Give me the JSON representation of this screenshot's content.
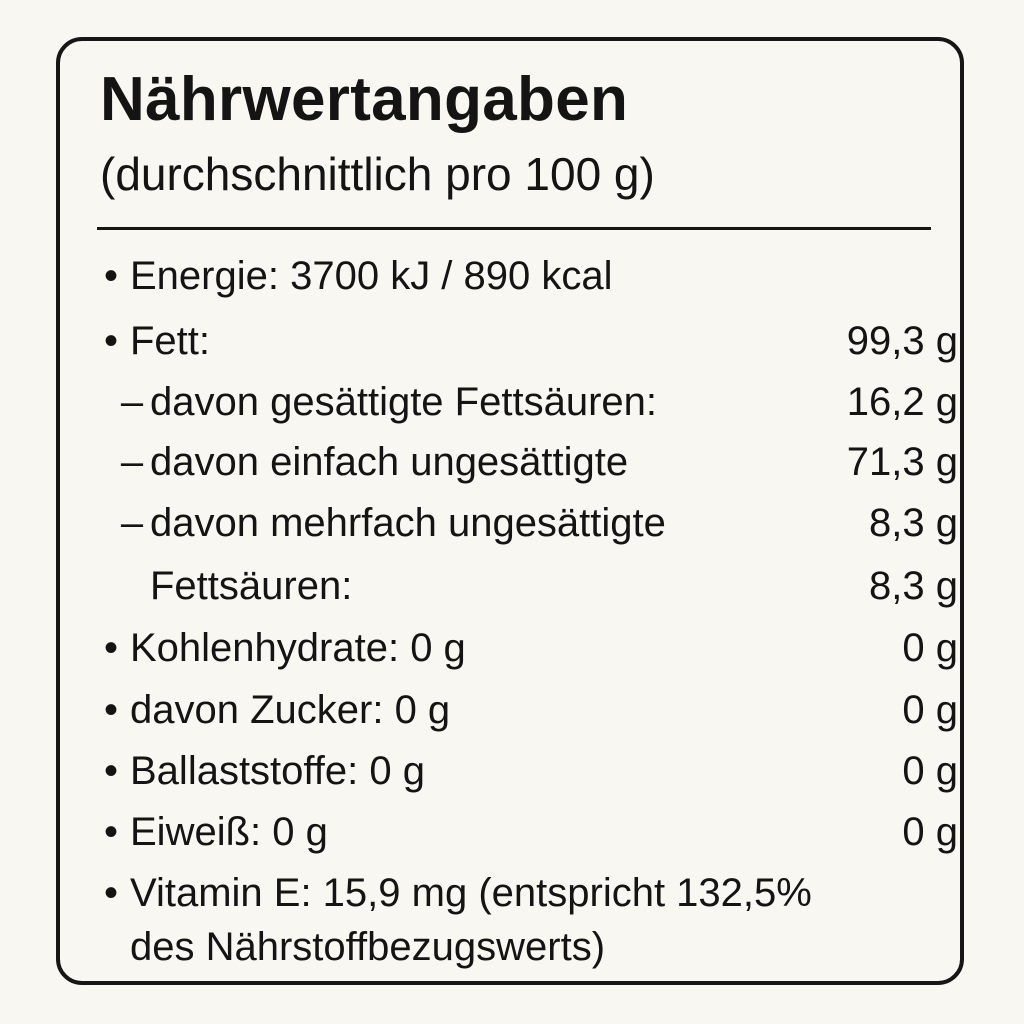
{
  "title": "Nährwertangaben",
  "subtitle": "(durchschnittlich pro 100 g)",
  "rows": [
    {
      "bullet": "•",
      "name": "Energie: 3700 kJ / 890 kcal",
      "value": ""
    },
    {
      "bullet": "•",
      "name": "Fett:",
      "value": "99,3 g"
    },
    {
      "dash": "–",
      "name": "davon gesättigte Fettsäuren:",
      "value": "16,2 g"
    },
    {
      "dash": "–",
      "name": "davon einfach ungesättigte",
      "value": "71,3 g"
    },
    {
      "dash": "–",
      "name": "davon mehrfach ungesättigte",
      "value": "8,3 g"
    },
    {
      "name": "Fettsäuren:",
      "value": "8,3 g"
    },
    {
      "bullet": "•",
      "name": "Kohlenhydrate: 0 g",
      "value": "0 g"
    },
    {
      "bullet": "•",
      "name": "davon Zucker: 0 g",
      "value": "0 g"
    },
    {
      "bullet": "•",
      "name": "Ballaststoffe: 0 g",
      "value": "0 g"
    },
    {
      "bullet": "•",
      "name": "Eiweiß: 0 g",
      "value": "0 g"
    },
    {
      "bullet": "•",
      "name": "Vitamin E: 15,9 mg (entspricht 132,5%",
      "value": ""
    },
    {
      "name": "des Nährstoffbezugswerts)",
      "value": ""
    }
  ]
}
